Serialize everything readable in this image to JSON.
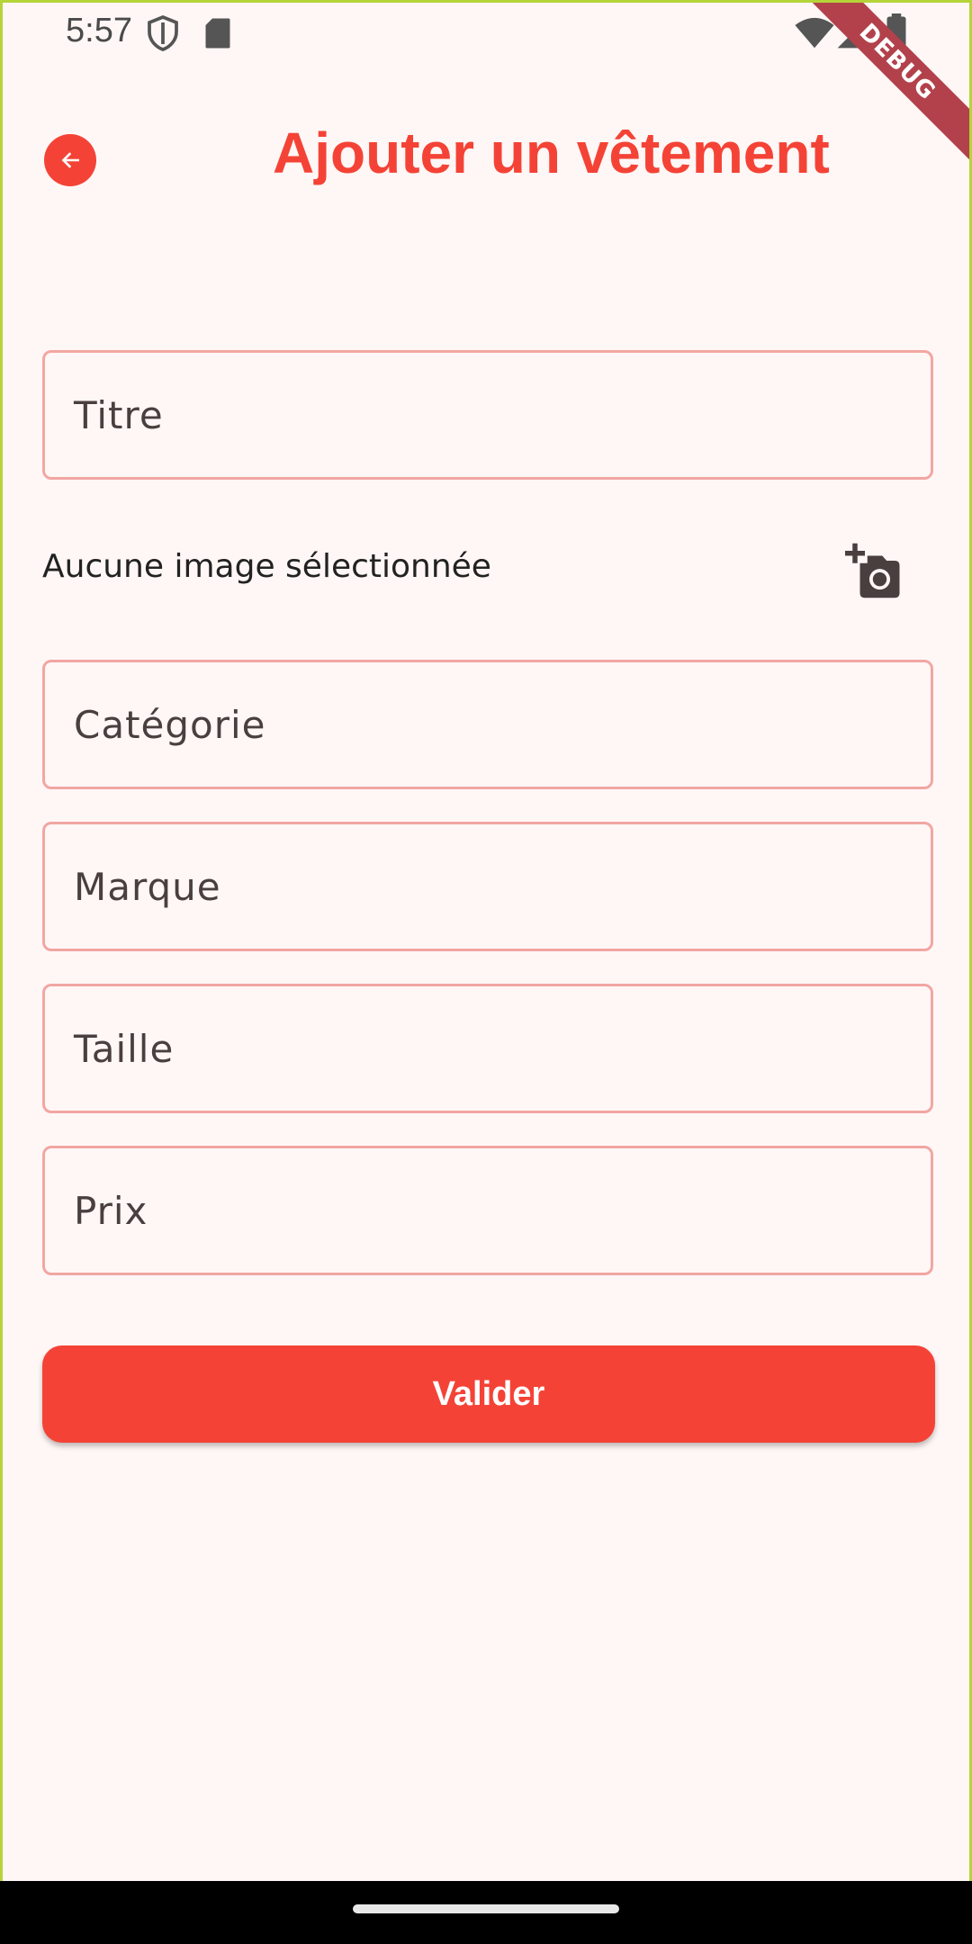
{
  "status_bar": {
    "time": "5:57",
    "icons": [
      "shield-icon",
      "sd-card-icon",
      "wifi-icon",
      "signal-icon",
      "battery-icon"
    ]
  },
  "debug_banner": "DEBUG",
  "header": {
    "title": "Ajouter un vêtement",
    "back_icon": "arrow-left-icon"
  },
  "form": {
    "title_label": "Titre",
    "image_status": "Aucune image sélectionnée",
    "camera_icon": "add-a-photo-icon",
    "category_label": "Catégorie",
    "brand_label": "Marque",
    "size_label": "Taille",
    "price_label": "Prix",
    "submit_label": "Valider"
  },
  "colors": {
    "primary": "#f44336",
    "border": "#f2a6a2",
    "background": "#fff7f6"
  }
}
